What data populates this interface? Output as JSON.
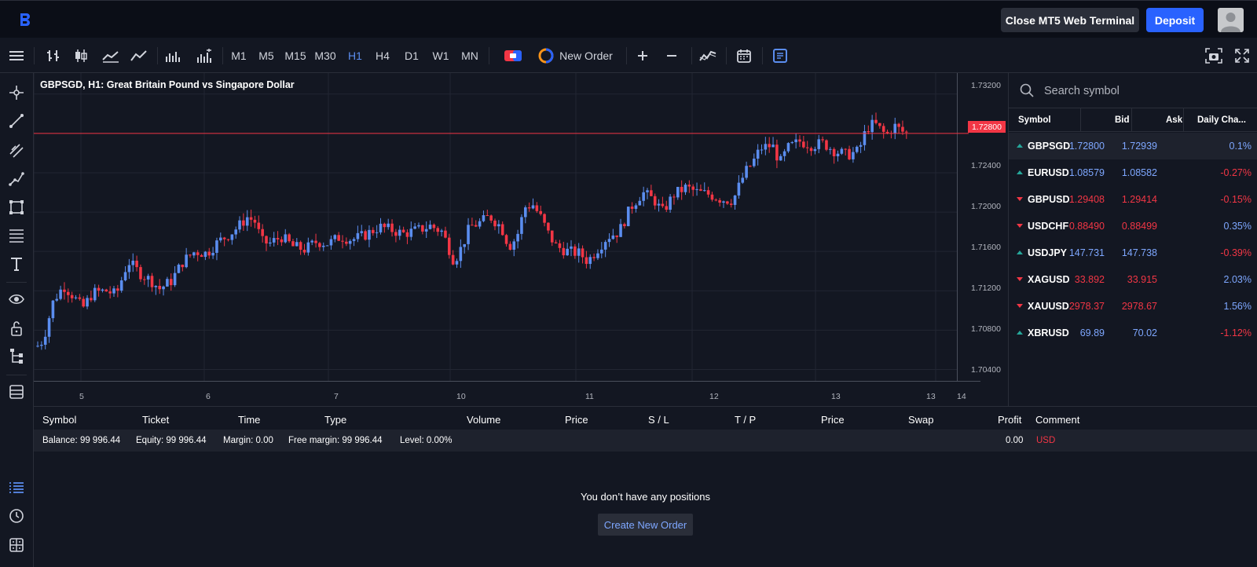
{
  "topbar": {
    "close_terminal": "Close MT5 Web Terminal",
    "deposit": "Deposit",
    "brand_color": "#2962ff"
  },
  "toolbar": {
    "timeframes": [
      "M1",
      "M5",
      "M15",
      "M30",
      "H1",
      "H4",
      "D1",
      "W1",
      "MN"
    ],
    "active_timeframe": "H1",
    "new_order": "New Order"
  },
  "chart": {
    "title": "GBPSGD, H1: Great Britain Pound vs Singapore Dollar",
    "current_price": "1.72800",
    "y_ticks": [
      "1.73200",
      "1.72400",
      "1.72000",
      "1.71600",
      "1.71200",
      "1.70800",
      "1.70400"
    ],
    "x_ticks": [
      "5",
      "6",
      "7",
      "10",
      "11",
      "12",
      "13",
      "13",
      "14"
    ],
    "up_color": "#5b8def",
    "down_color": "#f23645"
  },
  "watchlist": {
    "search_placeholder": "Search symbol",
    "headers": {
      "symbol": "Symbol",
      "bid": "Bid",
      "ask": "Ask",
      "change": "Daily Cha..."
    },
    "rows": [
      {
        "symbol": "GBPSGD",
        "bid": "1.72800",
        "ask": "1.72939",
        "change": "0.1%",
        "dir": "up",
        "bid_color": "#7ea7ff",
        "change_color": "#7ea7ff"
      },
      {
        "symbol": "EURUSD",
        "bid": "1.08579",
        "ask": "1.08582",
        "change": "-0.27%",
        "dir": "up",
        "bid_color": "#7ea7ff",
        "change_color": "#f23645"
      },
      {
        "symbol": "GBPUSD",
        "bid": "1.29408",
        "ask": "1.29414",
        "change": "-0.15%",
        "dir": "down",
        "bid_color": "#f23645",
        "change_color": "#f23645"
      },
      {
        "symbol": "USDCHF",
        "bid": "0.88490",
        "ask": "0.88499",
        "change": "0.35%",
        "dir": "down",
        "bid_color": "#f23645",
        "change_color": "#7ea7ff"
      },
      {
        "symbol": "USDJPY",
        "bid": "147.731",
        "ask": "147.738",
        "change": "-0.39%",
        "dir": "up",
        "bid_color": "#7ea7ff",
        "change_color": "#f23645"
      },
      {
        "symbol": "XAGUSD",
        "bid": "33.892",
        "ask": "33.915",
        "change": "2.03%",
        "dir": "down",
        "bid_color": "#f23645",
        "change_color": "#7ea7ff"
      },
      {
        "symbol": "XAUUSD",
        "bid": "2978.37",
        "ask": "2978.67",
        "change": "1.56%",
        "dir": "down",
        "bid_color": "#f23645",
        "change_color": "#7ea7ff"
      },
      {
        "symbol": "XBRUSD",
        "bid": "69.89",
        "ask": "70.02",
        "change": "-1.12%",
        "dir": "up",
        "bid_color": "#7ea7ff",
        "change_color": "#f23645"
      }
    ]
  },
  "positions": {
    "headers": [
      "Symbol",
      "Ticket",
      "Time",
      "Type",
      "Volume",
      "Price",
      "S / L",
      "T / P",
      "Price",
      "Swap",
      "Profit",
      "Comment"
    ],
    "balance": "Balance: 99 996.44",
    "equity": "Equity: 99 996.44",
    "margin": "Margin: 0.00",
    "free_margin": "Free margin: 99 996.44",
    "level": "Level: 0.00%",
    "profit": "0.00",
    "currency": "USD",
    "empty_message": "You don’t have any positions",
    "create_button": "Create New Order"
  }
}
